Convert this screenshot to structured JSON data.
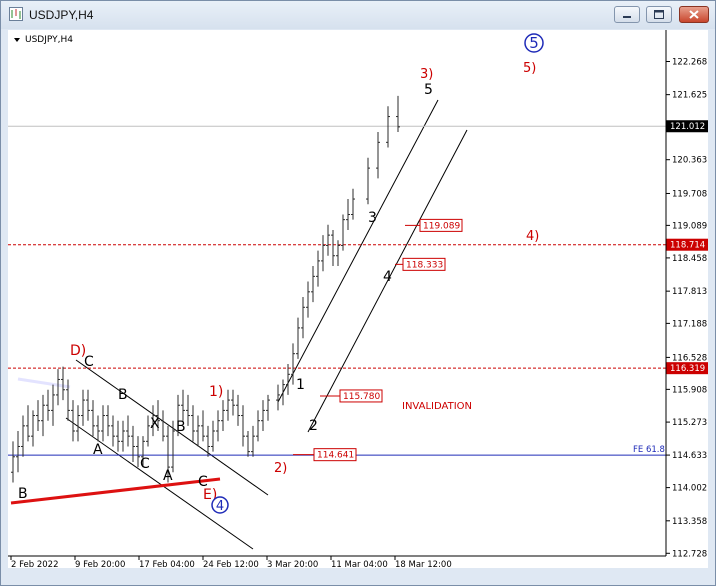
{
  "window": {
    "title": "USDJPY,H4"
  },
  "chart_data": {
    "type": "candlestick",
    "title": "USDJPY,H4",
    "ylim": [
      112.6,
      122.8
    ],
    "y_ticks": [
      "122.268",
      "121.625",
      "120.363",
      "119.708",
      "119.089",
      "118.458",
      "117.813",
      "117.188",
      "116.528",
      "115.908",
      "115.273",
      "114.633",
      "114.002",
      "113.358",
      "112.728"
    ],
    "x_ticks": [
      "2 Feb 2022",
      "9 Feb 20:00",
      "17 Feb 04:00",
      "24 Feb 12:00",
      "3 Mar 20:00",
      "11 Mar 04:00",
      "18 Mar 12:00"
    ],
    "current_price": {
      "value": 121.012,
      "label": "121.012"
    },
    "horizontal_levels": [
      {
        "value": 118.714,
        "label": "118.714",
        "style": "dashed",
        "color": "#cc0000"
      },
      {
        "value": 116.319,
        "label": "116.319",
        "style": "dashed",
        "color": "#cc0000"
      },
      {
        "value": 114.633,
        "label": "FE 61.8",
        "style": "solid",
        "color": "#1f2bb8"
      }
    ],
    "price_boxes": [
      {
        "value": 119.089,
        "label": "119.089"
      },
      {
        "value": 118.333,
        "label": "118.333"
      },
      {
        "value": 115.78,
        "label": "115.780"
      },
      {
        "value": 114.641,
        "label": "114.641"
      }
    ],
    "candles": [
      [
        114.3,
        114.9,
        114.1,
        114.6
      ],
      [
        114.6,
        115.1,
        114.3,
        114.8
      ],
      [
        114.8,
        115.4,
        114.6,
        115.2
      ],
      [
        115.2,
        115.6,
        114.9,
        115.0
      ],
      [
        115.0,
        115.5,
        114.8,
        115.4
      ],
      [
        115.4,
        115.7,
        115.1,
        115.3
      ],
      [
        115.3,
        115.8,
        115.0,
        115.6
      ],
      [
        115.6,
        115.9,
        115.3,
        115.5
      ],
      [
        115.5,
        116.0,
        115.2,
        115.8
      ],
      [
        115.8,
        116.3,
        115.6,
        116.1
      ],
      [
        116.1,
        116.35,
        115.7,
        115.9
      ],
      [
        115.9,
        116.1,
        115.3,
        115.5
      ],
      [
        115.5,
        115.7,
        114.9,
        115.1
      ],
      [
        115.1,
        115.6,
        114.9,
        115.4
      ],
      [
        115.4,
        115.9,
        115.2,
        115.7
      ],
      [
        115.7,
        115.9,
        115.3,
        115.5
      ],
      [
        115.5,
        115.7,
        115.0,
        115.2
      ],
      [
        115.2,
        115.4,
        114.9,
        115.1
      ],
      [
        115.1,
        115.6,
        114.9,
        115.4
      ],
      [
        115.4,
        115.6,
        115.0,
        115.2
      ],
      [
        115.2,
        115.4,
        114.8,
        115.0
      ],
      [
        115.0,
        115.3,
        114.7,
        114.9
      ],
      [
        114.9,
        115.3,
        114.7,
        115.1
      ],
      [
        115.1,
        115.4,
        114.8,
        115.0
      ],
      [
        115.0,
        115.2,
        114.5,
        114.8
      ],
      [
        114.8,
        115.0,
        114.4,
        114.6
      ],
      [
        114.6,
        115.0,
        114.4,
        114.9
      ],
      [
        114.9,
        115.4,
        114.8,
        115.2
      ],
      [
        115.2,
        115.6,
        115.0,
        115.4
      ],
      [
        115.4,
        115.7,
        115.1,
        115.3
      ],
      [
        115.3,
        115.5,
        114.9,
        115.0
      ],
      [
        115.0,
        115.2,
        114.1,
        114.4
      ],
      [
        114.4,
        115.3,
        114.3,
        115.1
      ],
      [
        115.1,
        115.8,
        115.0,
        115.6
      ],
      [
        115.6,
        115.9,
        115.3,
        115.5
      ],
      [
        115.5,
        115.8,
        115.2,
        115.4
      ],
      [
        115.4,
        115.6,
        114.9,
        115.1
      ],
      [
        115.1,
        115.4,
        114.8,
        115.2
      ],
      [
        115.2,
        115.5,
        114.9,
        115.0
      ],
      [
        115.0,
        115.2,
        114.6,
        114.8
      ],
      [
        114.8,
        115.3,
        114.7,
        115.1
      ],
      [
        115.1,
        115.5,
        114.9,
        115.3
      ],
      [
        115.3,
        115.7,
        115.1,
        115.5
      ],
      [
        115.5,
        115.9,
        115.3,
        115.7
      ],
      [
        115.7,
        115.9,
        115.4,
        115.6
      ],
      [
        115.6,
        115.8,
        115.2,
        115.4
      ],
      [
        115.4,
        115.6,
        114.8,
        115.0
      ],
      [
        115.0,
        115.1,
        114.6,
        114.7
      ],
      [
        114.7,
        115.2,
        114.6,
        115.0
      ],
      [
        115.0,
        115.5,
        114.9,
        115.3
      ],
      [
        115.3,
        115.7,
        115.1,
        115.5
      ],
      [
        115.5,
        115.8,
        115.3,
        115.7
      ],
      [
        115.7,
        116.0,
        115.5,
        115.8
      ],
      [
        115.8,
        116.1,
        115.6,
        116.0
      ],
      [
        116.0,
        116.4,
        115.8,
        116.2
      ],
      [
        116.2,
        116.8,
        116.0,
        116.6
      ],
      [
        116.6,
        117.3,
        116.5,
        117.1
      ],
      [
        117.1,
        117.7,
        116.9,
        117.5
      ],
      [
        117.5,
        118.0,
        117.3,
        117.8
      ],
      [
        117.8,
        118.3,
        117.6,
        118.1
      ],
      [
        118.1,
        118.6,
        117.9,
        118.4
      ],
      [
        118.4,
        118.9,
        118.2,
        118.7
      ],
      [
        118.7,
        119.1,
        118.5,
        118.9
      ],
      [
        118.9,
        119.0,
        118.3,
        118.5
      ],
      [
        118.5,
        118.8,
        118.3,
        118.7
      ],
      [
        118.7,
        119.3,
        118.6,
        119.2
      ],
      [
        119.2,
        119.6,
        119.0,
        119.3
      ],
      [
        119.3,
        119.8,
        119.2,
        119.6
      ],
      [
        119.6,
        120.4,
        119.5,
        120.2
      ],
      [
        120.2,
        120.9,
        120.0,
        120.7
      ],
      [
        120.7,
        121.4,
        120.6,
        121.2
      ],
      [
        121.2,
        121.6,
        120.9,
        121.0
      ]
    ],
    "annotations": [
      {
        "text": "D)",
        "color": "#cc0000"
      },
      {
        "text": "C",
        "color": "#000000"
      },
      {
        "text": "B",
        "color": "#000000"
      },
      {
        "text": "A",
        "color": "#000000"
      },
      {
        "text": "X",
        "color": "#000000"
      },
      {
        "text": "C",
        "color": "#000000"
      },
      {
        "text": "B",
        "color": "#000000"
      },
      {
        "text": "A",
        "color": "#000000"
      },
      {
        "text": "C",
        "color": "#000000"
      },
      {
        "text": "E)",
        "color": "#cc0000"
      },
      {
        "text": "B",
        "color": "#000000"
      },
      {
        "text": "1)",
        "color": "#cc0000"
      },
      {
        "text": "2)",
        "color": "#cc0000"
      },
      {
        "text": "1",
        "color": "#000000"
      },
      {
        "text": "2",
        "color": "#000000"
      },
      {
        "text": "3",
        "color": "#000000"
      },
      {
        "text": "4",
        "color": "#000000"
      },
      {
        "text": "3)",
        "color": "#cc0000"
      },
      {
        "text": "5",
        "color": "#000000"
      },
      {
        "text": "4)",
        "color": "#cc0000"
      },
      {
        "text": "5)",
        "color": "#cc0000"
      },
      {
        "text": "INVALIDATION",
        "color": "#cc0000"
      }
    ],
    "circled_labels": [
      {
        "text": "5",
        "color": "#1f2bb8"
      },
      {
        "text": "4",
        "color": "#1f2bb8"
      }
    ],
    "grid": false
  }
}
